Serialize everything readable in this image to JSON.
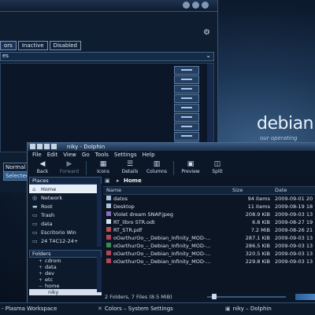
{
  "desktop": {
    "logo_text": "debian",
    "logo_tagline": "our operating system"
  },
  "colors_window": {
    "tabs": [
      "ors",
      "Inactive",
      "Disabled"
    ],
    "combo_label": "es",
    "preview_normal": "Normal",
    "preview_selected": "Selected"
  },
  "dolphin": {
    "title": "niky - Dolphin",
    "menu": [
      "File",
      "Edit",
      "View",
      "Go",
      "Tools",
      "Settings",
      "Help"
    ],
    "toolbar": {
      "back": "Back",
      "forward": "Forward",
      "icons": "Icons",
      "details": "Details",
      "columns": "Columns",
      "preview": "Preview",
      "split": "Split"
    },
    "places_header": "Places",
    "places": [
      "Home",
      "Network",
      "Root",
      "Trash",
      "data",
      "Escritorio Win",
      "24 T4C12-24+"
    ],
    "folders_header": "Folders",
    "folders": [
      "cdrom",
      "data",
      "dev",
      "etc",
      "home",
      "niky"
    ],
    "breadcrumb": "Home",
    "columns": {
      "name": "Name",
      "size": "Size",
      "date": "Date"
    },
    "files": [
      {
        "name": "datos",
        "size": "94 items",
        "date": "2009-09-01 20",
        "color": "#a8c1de"
      },
      {
        "name": "Desktop",
        "size": "11 items",
        "date": "2009-08-19 18",
        "color": "#a8c1de"
      },
      {
        "name": "Violet dream SNAP.jpeg",
        "size": "208.9 KiB",
        "date": "2009-09-03 13",
        "color": "#8a6cc0"
      },
      {
        "name": "RT_libro STR.odt",
        "size": "6.8 KiB",
        "date": "2009-08-27 19",
        "color": "#d6e1ee"
      },
      {
        "name": "RT_STR.pdf",
        "size": "7.2 MiB",
        "date": "2009-08-26 21",
        "color": "#c34b4b"
      },
      {
        "name": "oOarthurOo_-_Debian_Infinity_MOD-...",
        "size": "287.1 KiB",
        "date": "2009-09-03 13",
        "color": "#b3465a"
      },
      {
        "name": "oOarthurOo_-_Debian_Infinity_MOD-...",
        "size": "286.5 KiB",
        "date": "2009-09-03 13",
        "color": "#3a8a54"
      },
      {
        "name": "oOarthurOo_-_Debian_Infinity_MOD-...",
        "size": "320.5 KiB",
        "date": "2009-09-03 13",
        "color": "#b3465a"
      },
      {
        "name": "oOarthurOo_-_Debian_Infinity_MOD-...",
        "size": "229.8 KiB",
        "date": "2009-09-03 13",
        "color": "#b3465a"
      }
    ],
    "status": "2 Folders, 7 Files (8.5 MiB)"
  },
  "taskbar": {
    "items": [
      "- Plasma Workspace",
      "Colors – System Settings",
      "niky – Dolphin"
    ]
  }
}
